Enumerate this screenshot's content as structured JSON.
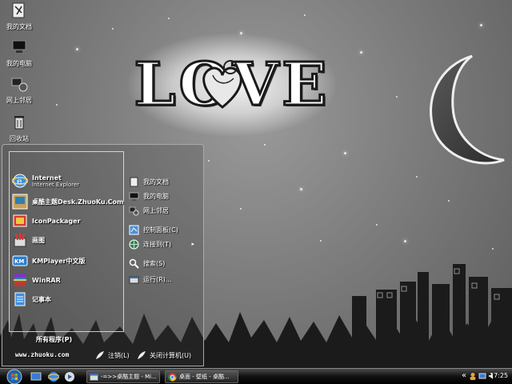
{
  "desktop": {
    "icons": [
      {
        "label": "我的文档",
        "icon": "my-documents-icon"
      },
      {
        "label": "我的电脑",
        "icon": "my-computer-icon"
      },
      {
        "label": "网上邻居",
        "icon": "network-places-icon"
      },
      {
        "label": "回收站",
        "icon": "recycle-bin-icon"
      }
    ],
    "wallpaper_text": "LOVE"
  },
  "start_menu": {
    "pinned": [
      {
        "title": "Internet",
        "subtitle": "Internet Explorer",
        "icon": "internet-explorer-icon"
      },
      {
        "title": "桌酷主题Desk.ZhuoKu.Com",
        "icon": "zhuoku-theme-icon"
      },
      {
        "title": "IconPackager",
        "icon": "iconpackager-icon"
      },
      {
        "title": "画图",
        "icon": "paint-icon"
      },
      {
        "title": "KMPlayer中文版",
        "icon": "kmplayer-icon"
      },
      {
        "title": "WinRAR",
        "icon": "winrar-icon"
      },
      {
        "title": "记事本",
        "icon": "notepad-icon"
      }
    ],
    "all_programs": "所有程序(P)",
    "places": [
      {
        "label": "我的文档",
        "icon": "my-documents-icon"
      },
      {
        "label": "我的电脑",
        "icon": "my-computer-icon"
      },
      {
        "label": "网上邻居",
        "icon": "network-places-icon"
      },
      {
        "label": "控制面板(C)",
        "icon": "control-panel-icon"
      },
      {
        "label": "连接到(T)",
        "icon": "connect-to-icon",
        "arrow": "▸"
      },
      {
        "label": "搜索(S)",
        "icon": "search-icon"
      },
      {
        "label": "运行(R)...",
        "icon": "run-icon"
      }
    ],
    "website": "www.zhuoku.com",
    "logoff": "注销(L)",
    "shutdown": "关闭计算机(U)"
  },
  "taskbar": {
    "tasks": [
      {
        "label": "-=>>桌酷主题 - Mi...",
        "icon": "explorer-window-icon"
      },
      {
        "label": "桌面 - 壁纸 - 桌酷...",
        "icon": "chrome-icon"
      }
    ],
    "tray_arrow": "«",
    "clock": "17:25"
  },
  "colors": {
    "taskbar": "#000000",
    "menu_border": "#aaaaaa",
    "wallpaper": "#7c7c7c"
  }
}
